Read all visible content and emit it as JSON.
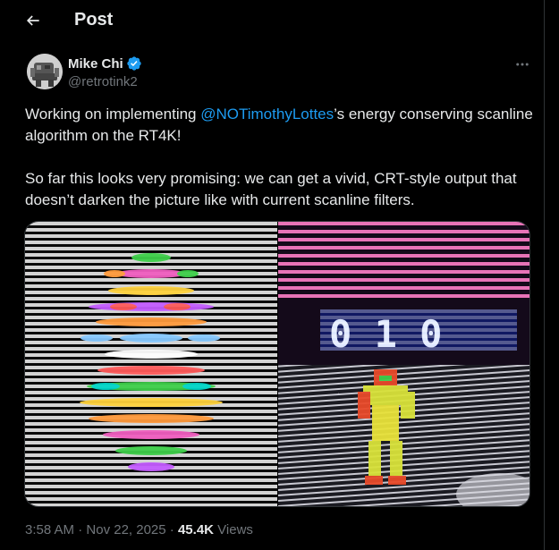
{
  "header": {
    "title": "Post"
  },
  "author": {
    "name": "Mike Chi",
    "handle": "@retrotink2"
  },
  "tweet": {
    "text_before_mention": "Working on implementing ",
    "mention": "@NOTimothyLottes",
    "text_after_mention": "’s energy conserving scanline algorithm on the RT4K!",
    "paragraph2": "So far this looks very promising: we can get a vivid, CRT-style output that doesn’t darken the picture like with current scanline filters."
  },
  "media": {
    "left_panel": "scanline-sprite-closeup",
    "right_top_panel": "scanline-score-display",
    "right_bottom_panel": "scanline-character-sprite"
  },
  "meta": {
    "time": "3:58 AM",
    "separator1": " · ",
    "date": "Nov 22, 2025",
    "separator2": " · ",
    "views_count": "45.4K",
    "views_label": " Views"
  },
  "colors": {
    "background": "#000000",
    "text": "#e7e9ea",
    "secondary": "#71767b",
    "accent": "#1d9bf0",
    "border": "#2f3336"
  },
  "icons": [
    "back-arrow-icon",
    "verified-badge-icon",
    "more-icon"
  ]
}
